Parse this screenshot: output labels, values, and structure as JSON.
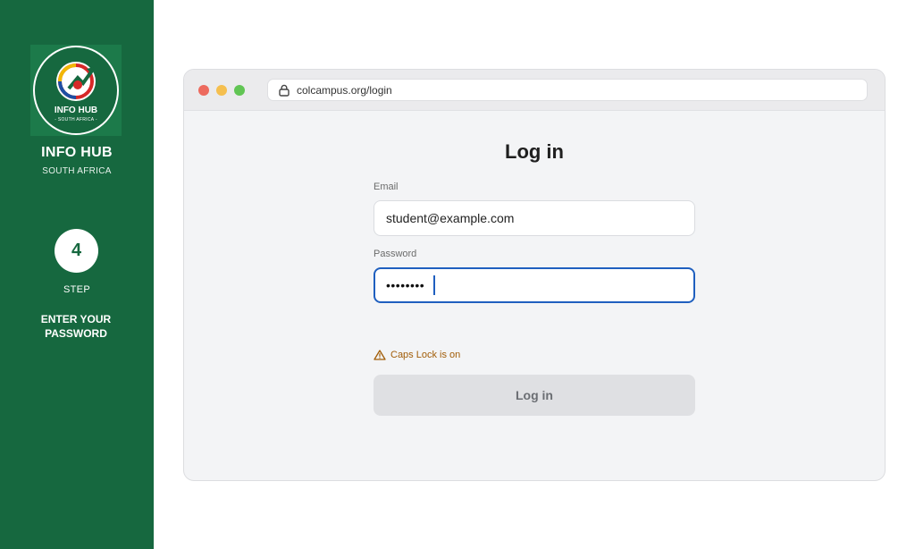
{
  "sidebar": {
    "logo": {
      "text": "INFO HUB",
      "subtext": "- SOUTH AFRICA -"
    },
    "brand_title": "INFO HUB",
    "brand_subtitle": "SOUTH AFRICA",
    "step": {
      "number": "4",
      "label": "STEP",
      "description": "ENTER YOUR PASSWORD"
    }
  },
  "browser": {
    "url": "colcampus.org/login",
    "icons": {
      "url": "lock-icon"
    }
  },
  "login": {
    "title": "Log in",
    "email_label": "Email",
    "email_value": "student@example.com",
    "password_label": "Password",
    "password_value": "••••••••",
    "caps_lock_warning": "Caps Lock is on",
    "submit_label": "Log in"
  },
  "colors": {
    "sidebar_green": "#16683f",
    "focus_blue": "#1f5fbf",
    "warning_amber": "#a15c07"
  }
}
